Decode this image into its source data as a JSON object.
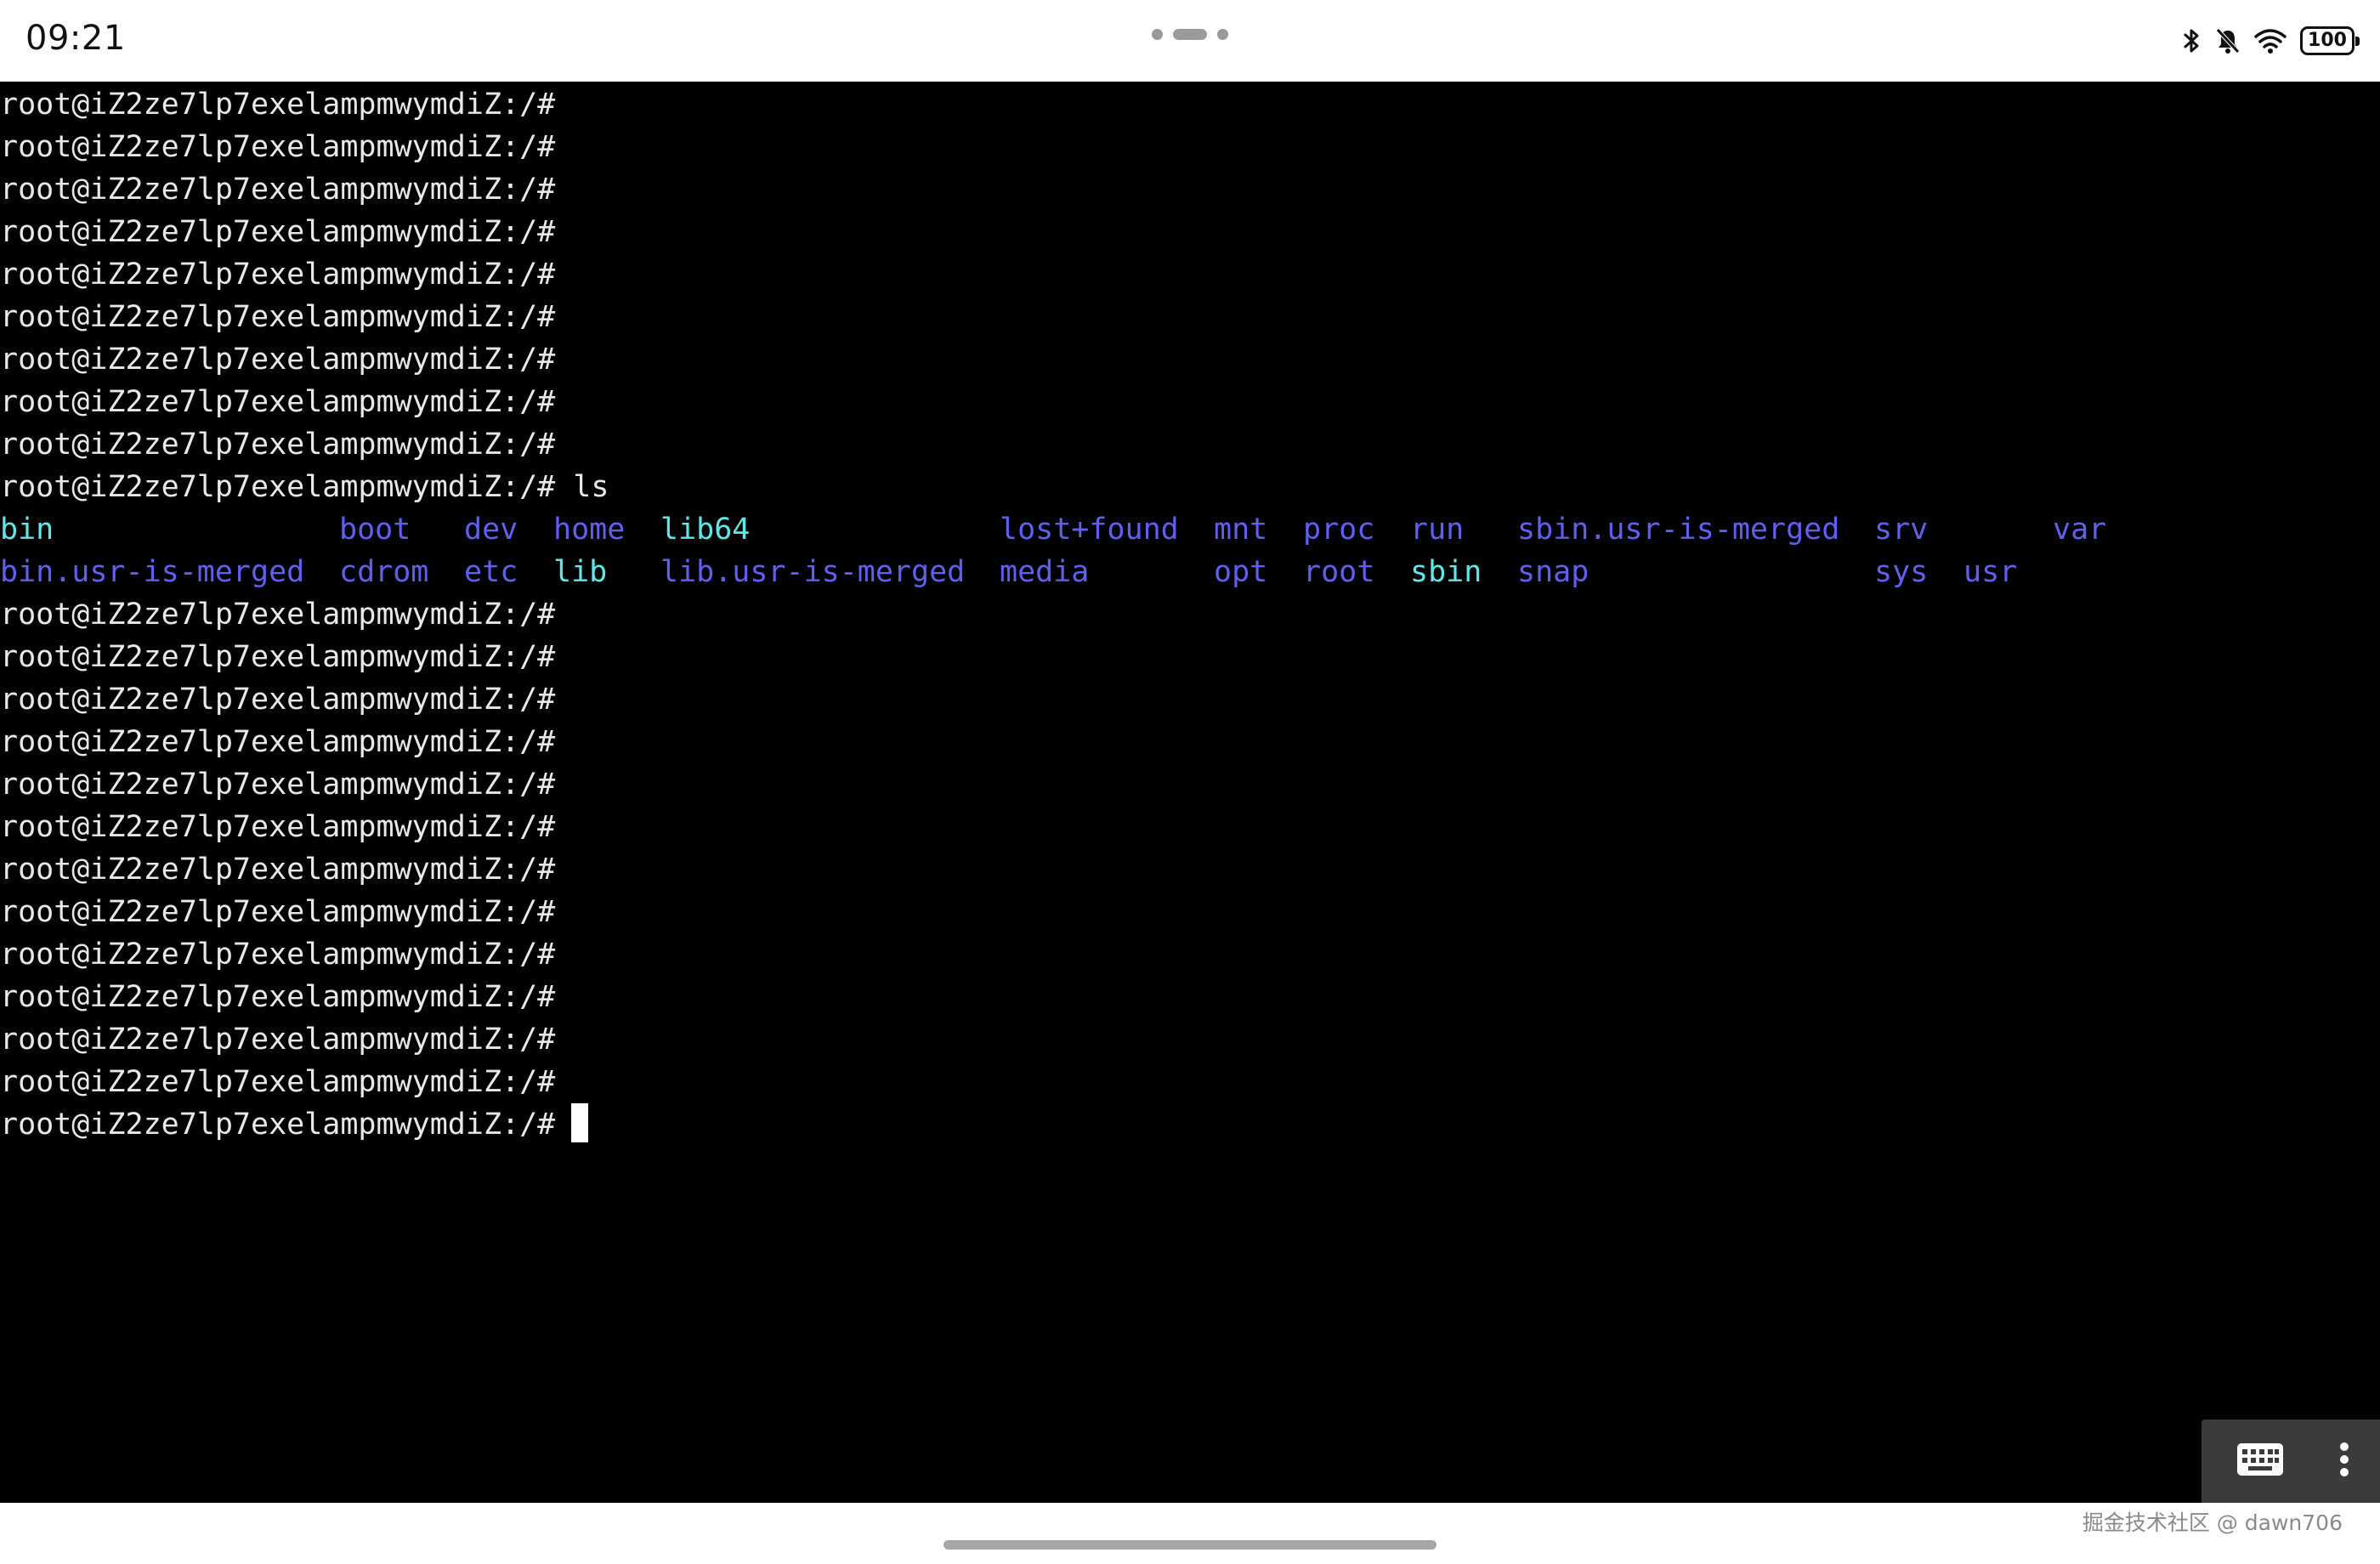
{
  "status_bar": {
    "time": "09:21",
    "battery": "100",
    "icons": [
      "bluetooth-icon",
      "bell-muted-icon",
      "wifi-icon",
      "battery-icon"
    ]
  },
  "terminal": {
    "prompt": "root@iZ2ze7lp7exelampmwymdiZ:/#",
    "lines_before": [
      "root@iZ2ze7lp7exelampmwymdiZ:/#",
      "root@iZ2ze7lp7exelampmwymdiZ:/#",
      "root@iZ2ze7lp7exelampmwymdiZ:/#",
      "root@iZ2ze7lp7exelampmwymdiZ:/#",
      "root@iZ2ze7lp7exelampmwymdiZ:/#",
      "root@iZ2ze7lp7exelampmwymdiZ:/#",
      "root@iZ2ze7lp7exelampmwymdiZ:/#",
      "root@iZ2ze7lp7exelampmwymdiZ:/#",
      "root@iZ2ze7lp7exelampmwymdiZ:/#"
    ],
    "command_line": "root@iZ2ze7lp7exelampmwymdiZ:/# ls",
    "ls_output": {
      "row1": [
        {
          "name": "bin",
          "kind": "link"
        },
        {
          "name": "boot",
          "kind": "dir"
        },
        {
          "name": "dev",
          "kind": "dir"
        },
        {
          "name": "home",
          "kind": "dir"
        },
        {
          "name": "lib64",
          "kind": "link"
        },
        {
          "name": "lost+found",
          "kind": "dir"
        },
        {
          "name": "mnt",
          "kind": "dir"
        },
        {
          "name": "proc",
          "kind": "dir"
        },
        {
          "name": "run",
          "kind": "dir"
        },
        {
          "name": "sbin.usr-is-merged",
          "kind": "dir"
        },
        {
          "name": "srv",
          "kind": "dir"
        },
        {
          "name": "var",
          "kind": "dir"
        }
      ],
      "row2": [
        {
          "name": "bin.usr-is-merged",
          "kind": "dir"
        },
        {
          "name": "cdrom",
          "kind": "dir"
        },
        {
          "name": "etc",
          "kind": "dir"
        },
        {
          "name": "lib",
          "kind": "link"
        },
        {
          "name": "lib.usr-is-merged",
          "kind": "dir"
        },
        {
          "name": "media",
          "kind": "dir"
        },
        {
          "name": "opt",
          "kind": "dir"
        },
        {
          "name": "root",
          "kind": "dir"
        },
        {
          "name": "sbin",
          "kind": "link"
        },
        {
          "name": "snap",
          "kind": "dir"
        },
        {
          "name": "sys",
          "kind": "dir"
        },
        {
          "name": "usr",
          "kind": "dir"
        }
      ]
    },
    "lines_after": [
      "root@iZ2ze7lp7exelampmwymdiZ:/#",
      "root@iZ2ze7lp7exelampmwymdiZ:/#",
      "root@iZ2ze7lp7exelampmwymdiZ:/#",
      "root@iZ2ze7lp7exelampmwymdiZ:/#",
      "root@iZ2ze7lp7exelampmwymdiZ:/#",
      "root@iZ2ze7lp7exelampmwymdiZ:/#",
      "root@iZ2ze7lp7exelampmwymdiZ:/#",
      "root@iZ2ze7lp7exelampmwymdiZ:/#",
      "root@iZ2ze7lp7exelampmwymdiZ:/#",
      "root@iZ2ze7lp7exelampmwymdiZ:/#",
      "root@iZ2ze7lp7exelampmwymdiZ:/#",
      "root@iZ2ze7lp7exelampmwymdiZ:/#",
      "root@iZ2ze7lp7exelampmwymdiZ:/#"
    ]
  },
  "colors": {
    "text": "#e8e8e8",
    "dir": "#5f5ff0",
    "link": "#5fe8e8",
    "cursor": "#ffffff",
    "background": "#000000"
  },
  "toolbar": {
    "keyboard_icon": "keyboard-icon",
    "more_icon": "more-vertical-icon"
  },
  "watermark": "掘金技术社区 @ dawn706"
}
